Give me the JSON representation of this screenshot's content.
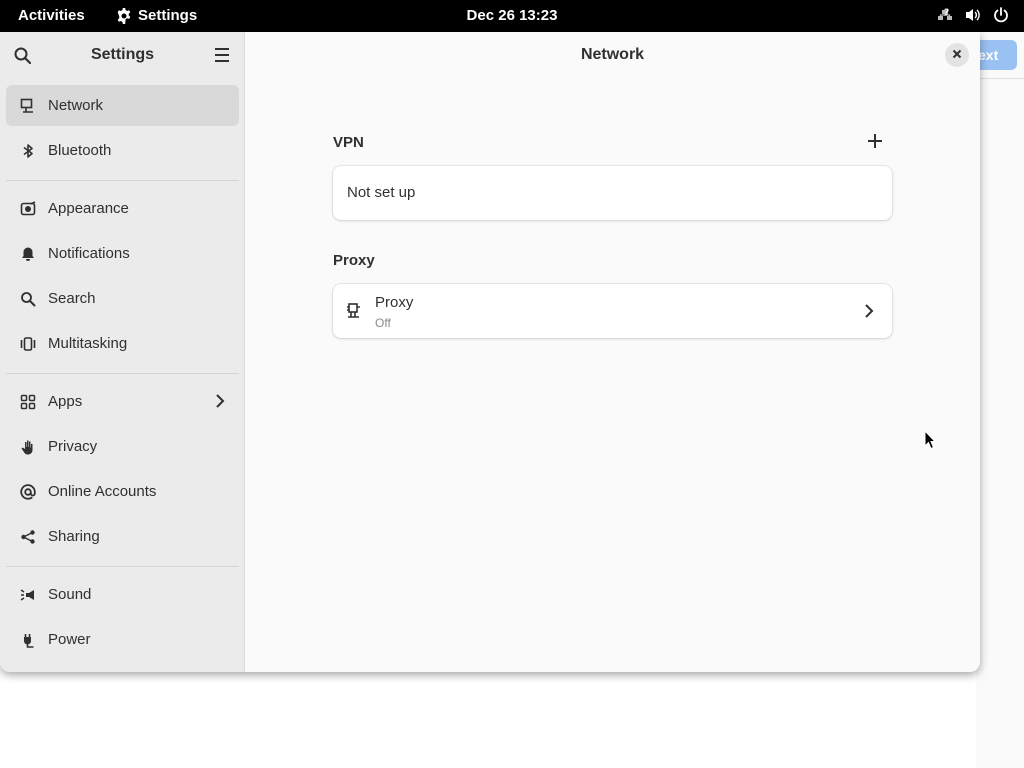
{
  "topbar": {
    "activities": "Activities",
    "app_name": "Settings",
    "clock": "Dec 26  13:23"
  },
  "background_window": {
    "button_text": "ext"
  },
  "sidebar": {
    "title": "Settings",
    "items": [
      {
        "label": "Network",
        "icon": "network-icon",
        "active": true
      },
      {
        "label": "Bluetooth",
        "icon": "bluetooth-icon"
      },
      {
        "label": "Appearance",
        "icon": "appearance-icon"
      },
      {
        "label": "Notifications",
        "icon": "bell-icon"
      },
      {
        "label": "Search",
        "icon": "search-icon"
      },
      {
        "label": "Multitasking",
        "icon": "multitasking-icon"
      },
      {
        "label": "Apps",
        "icon": "apps-icon",
        "has_submenu": true
      },
      {
        "label": "Privacy",
        "icon": "hand-icon"
      },
      {
        "label": "Online Accounts",
        "icon": "at-icon"
      },
      {
        "label": "Sharing",
        "icon": "share-icon"
      },
      {
        "label": "Sound",
        "icon": "speaker-icon"
      },
      {
        "label": "Power",
        "icon": "plug-icon"
      }
    ]
  },
  "main": {
    "title": "Network",
    "vpn": {
      "heading": "VPN",
      "status": "Not set up"
    },
    "proxy": {
      "heading": "Proxy",
      "row_label": "Proxy",
      "row_value": "Off"
    }
  },
  "colors": {
    "topbar_bg": "#000000",
    "sidebar_bg": "#ebebeb",
    "active_item": "#d9d9d9",
    "content_bg": "#fafafa",
    "accent_button": "#99c1f1"
  }
}
